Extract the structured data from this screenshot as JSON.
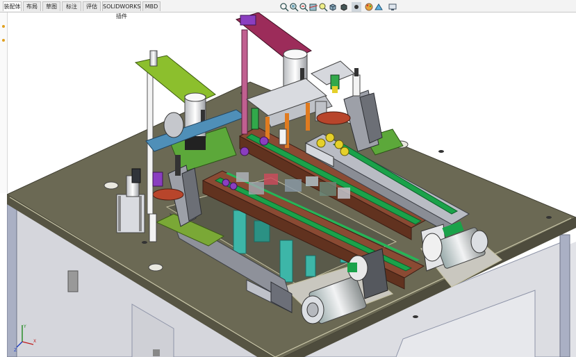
{
  "tabs": [
    {
      "label": "装配体",
      "active": true
    },
    {
      "label": "布局",
      "active": false
    },
    {
      "label": "草图",
      "active": false
    },
    {
      "label": "标注",
      "active": false
    },
    {
      "label": "评估",
      "active": false
    },
    {
      "label": "SOLIDWORKS 插件",
      "active": false
    },
    {
      "label": "MBD",
      "active": false
    }
  ],
  "toolbar": {
    "icons": [
      "zoom-to-fit-icon",
      "zoom-area-icon",
      "previous-view-icon",
      "section-view-icon",
      "dynamic-annotation-icon",
      "view-orientation-icon",
      "display-style-icon",
      "hide-show-items-icon",
      "edit-appearance-icon",
      "apply-scene-icon",
      "view-settings-icon"
    ]
  },
  "triad": {
    "x": "X",
    "y": "Y",
    "z": "Z"
  },
  "colors": {
    "table_top": "#6b6954",
    "frame": "#9aa0b4",
    "belt": "#8a4a33",
    "belt_stripe": "#1aa24a",
    "green_plate": "#7aa836",
    "magenta_arm": "#9c2c5a",
    "teal": "#3db6a8",
    "steel": "#c9ccd4",
    "purple": "#8a3ec0"
  }
}
